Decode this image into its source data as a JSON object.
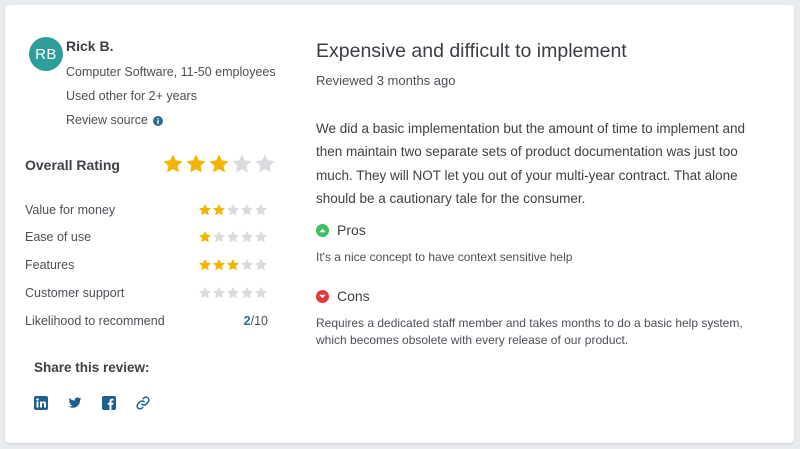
{
  "reviewer": {
    "initials": "RB",
    "avatar_color": "#2f9e9b",
    "name": "Rick B.",
    "company": "Computer Software, 11-50 employees",
    "usage": "Used other for 2+ years",
    "source_label": "Review source"
  },
  "ratings": {
    "overall_label": "Overall Rating",
    "overall_stars": 3,
    "items": [
      {
        "label": "Value for money",
        "stars": 2
      },
      {
        "label": "Ease of use",
        "stars": 1
      },
      {
        "label": "Features",
        "stars": 3
      },
      {
        "label": "Customer support",
        "stars": 0
      }
    ],
    "recommend": {
      "label": "Likelihood to recommend",
      "score": "2",
      "out_of": "/10"
    }
  },
  "share": {
    "title": "Share this review:",
    "icons": [
      "linkedin-icon",
      "twitter-icon",
      "facebook-icon",
      "link-icon"
    ]
  },
  "review": {
    "title": "Expensive and difficult to implement",
    "reviewed": "Reviewed 3 months ago",
    "body": "We did a basic implementation but the amount of time to implement and then maintain two separate sets of product documentation was just too much. They will NOT let you out of your multi-year contract. That alone should be a cautionary tale for the consumer.",
    "pros_label": "Pros",
    "pros_text": "It's a nice concept to have context sensitive help",
    "cons_label": "Cons",
    "cons_text": "Requires a dedicated staff member and takes months to do a basic help system, which becomes obsolete with every release of our product."
  },
  "colors": {
    "star_filled": "#f5b400",
    "star_empty": "#d9dbde",
    "pros": "#3fbf5f",
    "cons": "#e0383b",
    "share_icon": "#1f5f8b",
    "info_icon": "#2b6f8a"
  }
}
